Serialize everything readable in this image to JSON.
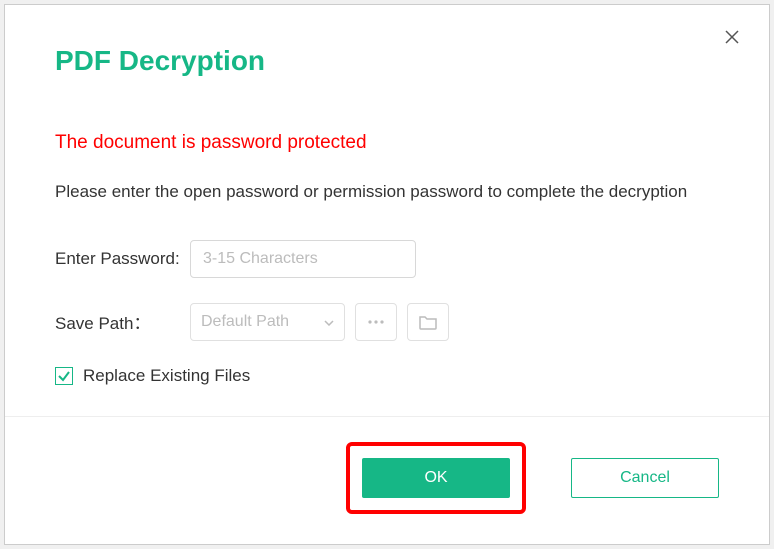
{
  "title": "PDF Decryption",
  "warning": "The document is password protected",
  "instruction": "Please enter the open password or permission password to complete the decryption",
  "password": {
    "label": "Enter Password:",
    "placeholder": "3-15 Characters",
    "value": ""
  },
  "savePath": {
    "label": "Save Path：",
    "selected": "Default Path"
  },
  "replace": {
    "label": "Replace Existing Files",
    "checked": true
  },
  "buttons": {
    "ok": "OK",
    "cancel": "Cancel"
  },
  "colors": {
    "accent": "#16b786",
    "danger": "#ff0000"
  }
}
